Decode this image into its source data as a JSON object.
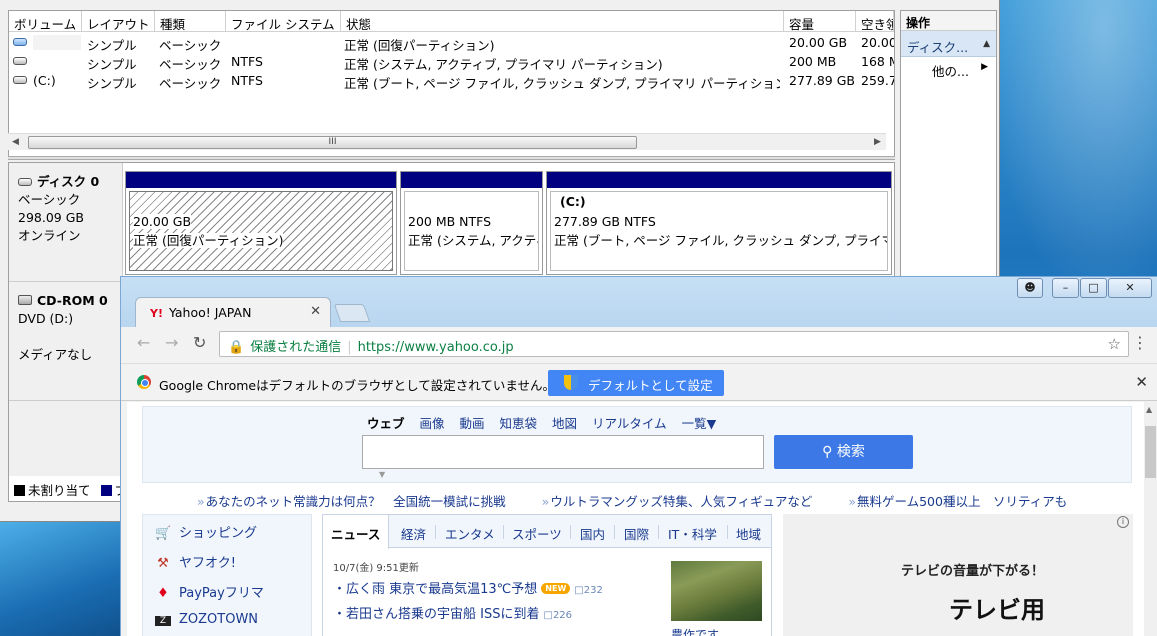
{
  "disk_mgmt": {
    "columns": [
      "ボリューム",
      "レイアウト",
      "種類",
      "ファイル システム",
      "状態",
      "容量",
      "空き領"
    ],
    "rows": [
      {
        "volume": "",
        "layout": "シンプル",
        "type": "ベーシック",
        "fs": "",
        "status": "正常 (回復パーティション)",
        "capacity": "20.00 GB",
        "free": "20.00"
      },
      {
        "volume": "",
        "layout": "シンプル",
        "type": "ベーシック",
        "fs": "NTFS",
        "status": "正常 (システム, アクティブ, プライマリ パーティション)",
        "capacity": "200 MB",
        "free": "168 M"
      },
      {
        "volume": "(C:)",
        "layout": "シンプル",
        "type": "ベーシック",
        "fs": "NTFS",
        "status": "正常 (ブート, ページ ファイル, クラッシュ ダンプ, プライマリ パーティション)",
        "capacity": "277.89 GB",
        "free": "259.7"
      }
    ],
    "scroll_grip": "III",
    "actions": {
      "header": "操作",
      "item1": "ディスク...",
      "item2": "他の..."
    },
    "disk0": {
      "name": "ディスク 0",
      "type": "ベーシック",
      "size": "298.09 GB",
      "state": "オンライン"
    },
    "partitions": [
      {
        "title": "",
        "size": "20.00 GB",
        "status": "正常 (回復パーティション)"
      },
      {
        "title": "",
        "size": "200 MB NTFS",
        "status": "正常 (システム, アクティ"
      },
      {
        "title": "(C:)",
        "size": "277.89 GB NTFS",
        "status": "正常 (ブート, ページ ファイル, クラッシュ ダンプ, プライマリ"
      }
    ],
    "cdrom": {
      "name": "CD-ROM 0",
      "drive": "DVD (D:)",
      "media": "メディアなし"
    },
    "legend": {
      "unallocated": "未割り当て",
      "primary": "プ"
    },
    "colors": {
      "unallocated": "#000000",
      "primary": "#000080"
    }
  },
  "chrome": {
    "tab_title": "Yahoo! JAPAN",
    "tab_logo": "Y!",
    "secure_label": "保護された通信",
    "url": "https://www.yahoo.co.jp",
    "infobar_message": "Google Chromeはデフォルトのブラウザとして設定されていません。",
    "infobar_button": "デフォルトとして設定"
  },
  "yahoo": {
    "search_tabs": [
      "ウェブ",
      "画像",
      "動画",
      "知恵袋",
      "地図",
      "リアルタイム",
      "一覧▼"
    ],
    "search_button": "検索",
    "promos": [
      "あなたのネット常識力は何点？　全国統一模試に挑戦",
      "ウルトラマングッズ特集、人気フィギュアなど",
      "無料ゲーム500種以上　ソリティアも"
    ],
    "menu": [
      "ショッピング",
      "ヤフオク!",
      "PayPayフリマ",
      "ZOZOTOWN"
    ],
    "news_tabs": [
      "ニュース",
      "経済",
      "エンタメ",
      "スポーツ",
      "国内",
      "国際",
      "IT・科学",
      "地域"
    ],
    "news_time": "10/7(金) 9:51更新",
    "headlines": [
      {
        "text": "・広く雨 東京で最高気温13℃予想",
        "badge": "NEW",
        "comments": "232"
      },
      {
        "text": "・若田さん搭乗の宇宙船 ISSに到着",
        "badge": "",
        "comments": "226"
      }
    ],
    "image_caption": "農作です",
    "ad_line1": "テレビの音量が下がる！",
    "ad_line2": "テレビ用",
    "brand_color": "#e0001c"
  }
}
